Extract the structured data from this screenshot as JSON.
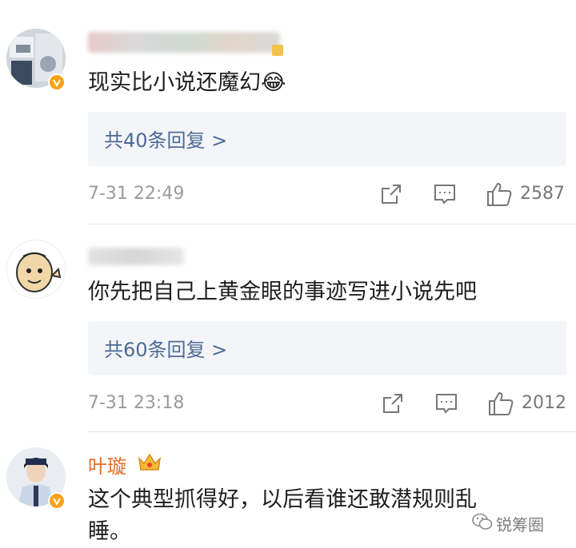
{
  "comments": [
    {
      "text": "现实比小说还魔幻😂",
      "replies_label": "共40条回复 >",
      "time": "7-31 22:49",
      "likes": "2587",
      "verified": true,
      "username_hidden": true
    },
    {
      "text": "你先把自己上黄金眼的事迹写进小说先吧",
      "replies_label": "共60条回复 >",
      "time": "7-31 23:18",
      "likes": "2012",
      "verified": false,
      "username_hidden": true
    },
    {
      "username": "叶璇",
      "text_line1": "这个典型抓得好，以后看谁还敢潜规则乱",
      "text_line2": "睡。",
      "verified": true
    }
  ],
  "watermark": "锐筹圈",
  "icons": [
    "share-icon",
    "comment-icon",
    "like-icon",
    "crown-icon",
    "wechat-icon"
  ],
  "colors": {
    "username": "#e86b1f",
    "reply_link": "#4d6a96",
    "reply_bg": "#f4f5f8",
    "verified_badge": "#f7a21b"
  }
}
